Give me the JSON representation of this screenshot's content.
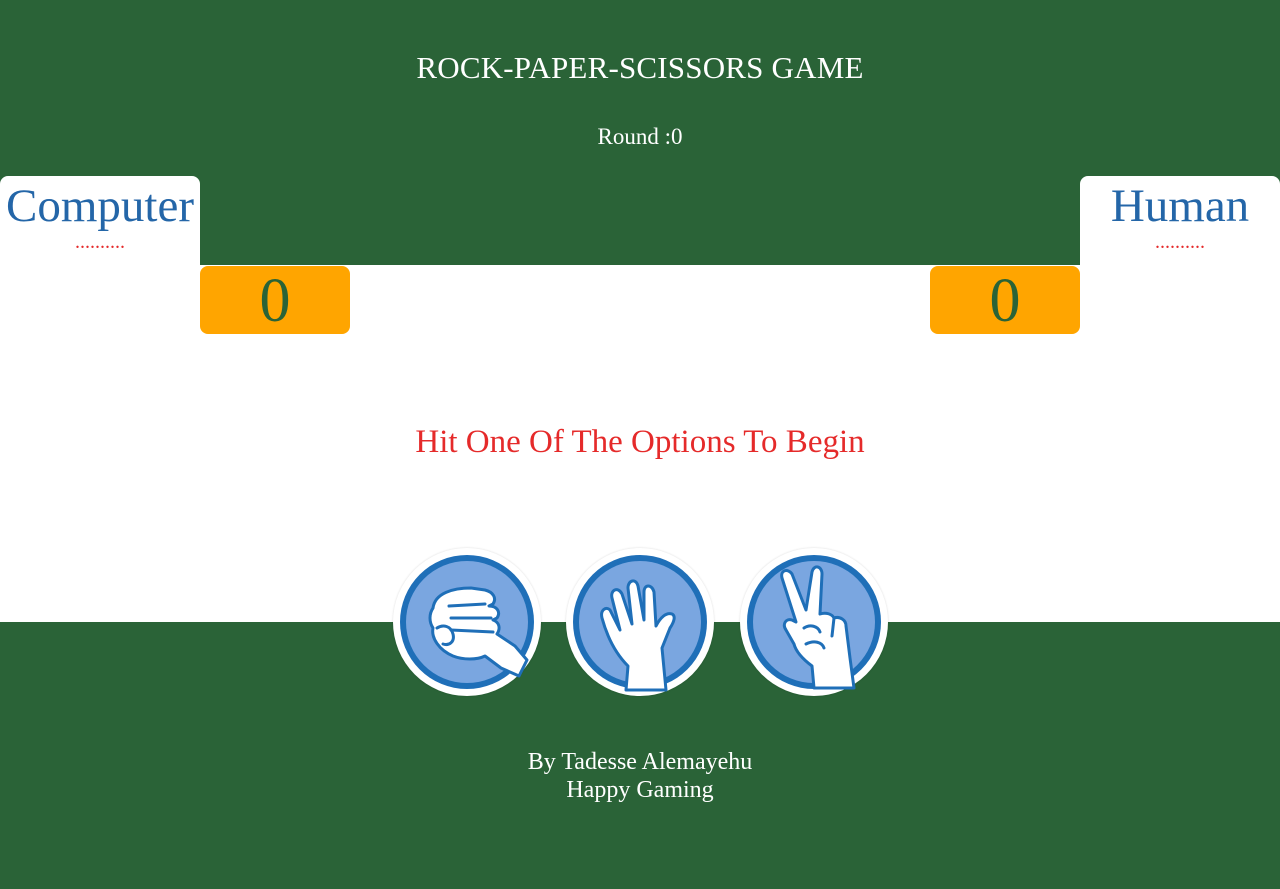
{
  "header": {
    "title": "ROCK-PAPER-SCISSORS GAME",
    "round_label": "Round :",
    "round_value": "0"
  },
  "players": {
    "computer": {
      "name": "Computer",
      "choice": "..........",
      "score": "0"
    },
    "human": {
      "name": "Human",
      "choice": "..........",
      "score": "0"
    }
  },
  "message": "Hit One Of The Options To Begin",
  "options": [
    {
      "name": "rock",
      "icon": "rock-fist-icon"
    },
    {
      "name": "paper",
      "icon": "paper-open-hand-icon"
    },
    {
      "name": "scissors",
      "icon": "scissors-peace-hand-icon"
    }
  ],
  "footer": {
    "author": "By Tadesse Alemayehu",
    "tagline": "Happy Gaming"
  },
  "colors": {
    "background_green": "#2a6337",
    "score_orange": "#ffa500",
    "player_blue": "#2466a8",
    "message_red": "#e52a2a",
    "icon_blue": "#1f6fb8",
    "icon_fill": "#7aa6e0"
  }
}
